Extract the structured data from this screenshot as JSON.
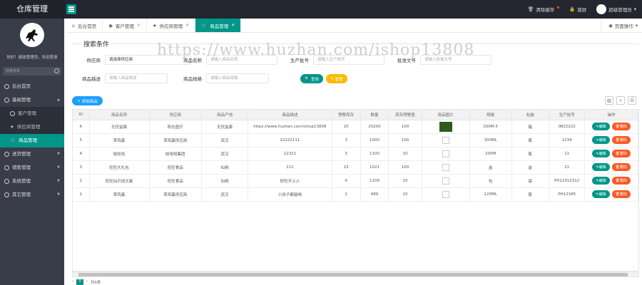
{
  "app": {
    "title": "仓库管理"
  },
  "topbar": {
    "clear_cache": "清除缓存",
    "lock": "锁屏",
    "user": "超级管理员"
  },
  "sidebar": {
    "welcome": "你好！超级管理员，欢迎登录",
    "search_placeholder": "搜索菜单",
    "items": [
      {
        "label": "后台首页"
      },
      {
        "label": "基础管理",
        "expanded": true,
        "children": [
          {
            "label": "客户管理"
          },
          {
            "label": "供应商管理"
          },
          {
            "label": "商品管理",
            "active": true
          }
        ]
      },
      {
        "label": "进货管理"
      },
      {
        "label": "销售管理"
      },
      {
        "label": "系统管理"
      },
      {
        "label": "其它管理"
      }
    ]
  },
  "tabs": [
    {
      "label": "后台首页",
      "icon": "home-icon"
    },
    {
      "label": "客户管理",
      "icon": "user-icon",
      "closable": true
    },
    {
      "label": "供应商管理",
      "icon": "star-icon",
      "closable": true
    },
    {
      "label": "商品管理",
      "icon": "cart-icon",
      "closable": true,
      "active": true
    }
  ],
  "page_ops": "页面操作",
  "search": {
    "legend": "搜索条件",
    "fields": [
      {
        "label": "供应商",
        "value": "请选择供应商",
        "placeholder": ""
      },
      {
        "label": "商品名称",
        "value": "",
        "placeholder": "请输入商品名称"
      },
      {
        "label": "生产批号",
        "value": "",
        "placeholder": "请输入生产批号"
      },
      {
        "label": "批准文号",
        "value": "",
        "placeholder": "请输入批准文号"
      },
      {
        "label": "商品描述",
        "value": "",
        "placeholder": "请输入商品描述"
      },
      {
        "label": "商品规格",
        "value": "",
        "placeholder": "请输入商品规格"
      }
    ],
    "search_btn": "查询",
    "reset_btn": "重置"
  },
  "toolbar": {
    "add_btn": "添加商品"
  },
  "table": {
    "columns": [
      "ID",
      "商品名称",
      "供应商",
      "商品产地",
      "商品描述",
      "预警库存",
      "数量",
      "库存预警值",
      "商品图片",
      "规格",
      "包装",
      "生产批号",
      "操作"
    ],
    "edit_label": "编辑",
    "delete_label": "删除",
    "rows": [
      {
        "id": "6",
        "name": "无忧益康",
        "supplier": "阳光医疗",
        "origin": "无忧益康",
        "desc": "https://www.huzhan.com/ishop13808",
        "warn": "20",
        "qty": "20200",
        "threshold": "100",
        "img": "photo",
        "spec": "200M-5",
        "pack": "箱",
        "batch": "0822222"
      },
      {
        "id": "5",
        "name": "草鸡蛋",
        "supplier": "草鸡蛋供应商",
        "origin": "武汉",
        "desc": "22222111",
        "warn": "3",
        "qty": "1000",
        "threshold": "100",
        "img": "broken",
        "spec": "300ML",
        "pack": "瓶",
        "batch": "1234"
      },
      {
        "id": "4",
        "name": "娃哈哈",
        "supplier": "娃哈哈集团",
        "origin": "武汉",
        "desc": "12321",
        "warn": "3",
        "qty": "1100",
        "threshold": "10",
        "img": "broken",
        "spec": "200M",
        "pack": "瓶",
        "batch": "11"
      },
      {
        "id": "3",
        "name": "旺旺大礼包",
        "supplier": "旺旺食品",
        "origin": "仙桃",
        "desc": "111",
        "warn": "23",
        "qty": "1021",
        "threshold": "100",
        "img": "broken",
        "spec": "盒",
        "pack": "盒",
        "batch": "11"
      },
      {
        "id": "2",
        "name": "旺旺仙贝加大装",
        "supplier": "旺旺食品",
        "origin": "仙桃",
        "desc": "好吃不上火",
        "warn": "4",
        "qty": "1109",
        "threshold": "10",
        "img": "broken",
        "spec": "包",
        "pack": "袋",
        "batch": "PH12312312"
      },
      {
        "id": "1",
        "name": "草鸡蛋",
        "supplier": "草鸡蛋供应商",
        "origin": "武汉",
        "desc": "小孩子都能喝",
        "warn": "2",
        "qty": "489",
        "threshold": "10",
        "img": "broken",
        "spec": "120ML",
        "pack": "瓶",
        "batch": "PH12345"
      }
    ]
  },
  "pager": {
    "current": "1",
    "total_label": "共6条"
  },
  "watermark": "https://www.huzhan.com/ishop13808",
  "colors": {
    "accent": "#009688",
    "danger": "#ff5722",
    "warn": "#ffb800",
    "blue": "#1e9fff",
    "sidebar": "#393d49"
  }
}
